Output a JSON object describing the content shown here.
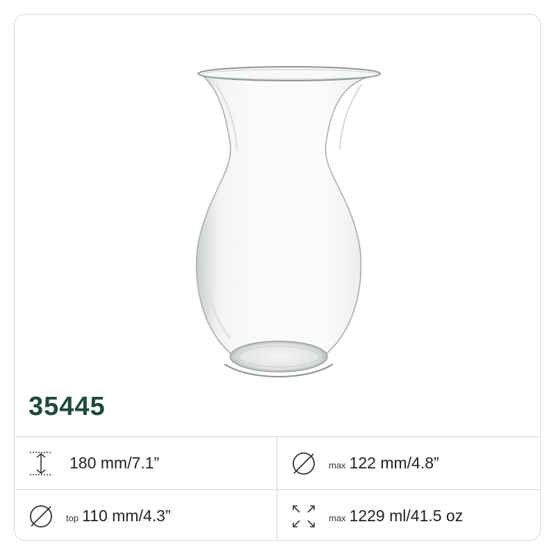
{
  "product": {
    "code": "35445",
    "image_alt": "clear glass vase"
  },
  "specs": [
    {
      "icon": "height-icon",
      "prefix": "",
      "value": "180 mm/7.1”"
    },
    {
      "icon": "diameter-icon",
      "prefix": "max",
      "value": "122 mm/4.8”"
    },
    {
      "icon": "diameter-icon",
      "prefix": "top",
      "value": "110 mm/4.3”"
    },
    {
      "icon": "volume-icon",
      "prefix": "max",
      "value": "1229 ml/41.5 oz"
    }
  ],
  "colors": {
    "code_color": "#1e4a3a",
    "border": "#d6d6d6",
    "icon_stroke": "#333333"
  }
}
